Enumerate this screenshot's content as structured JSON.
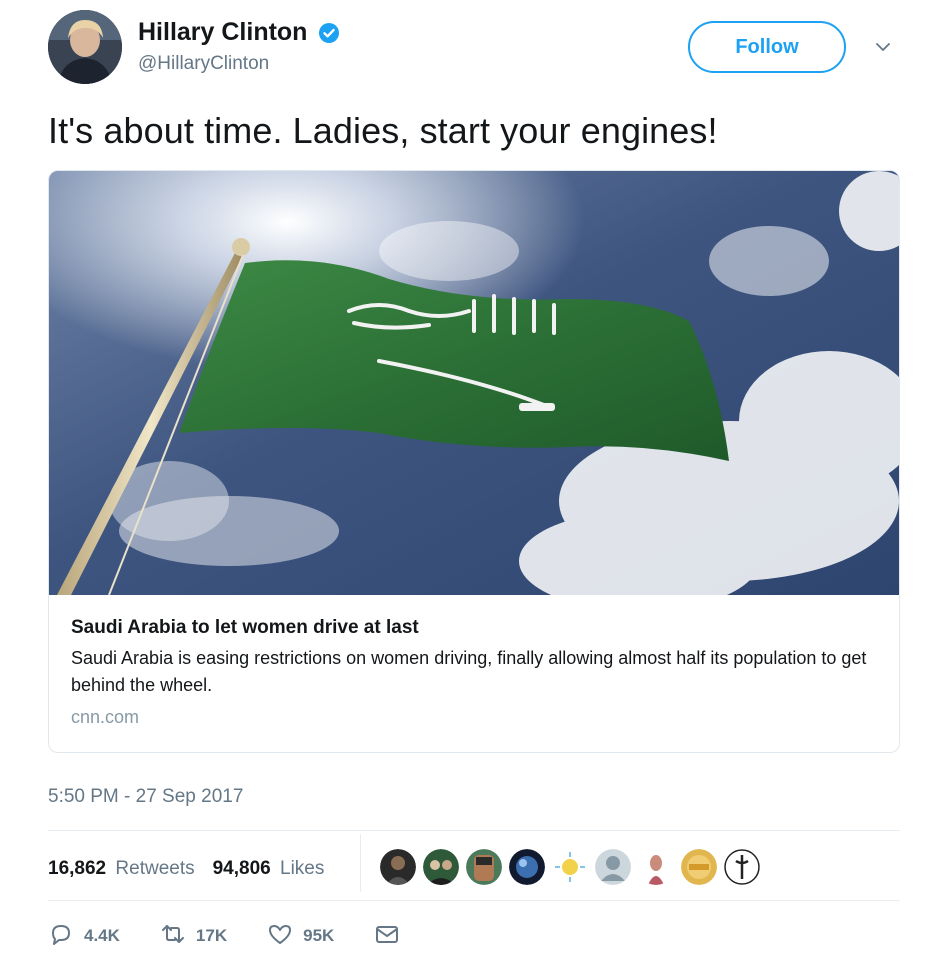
{
  "author": {
    "name": "Hillary Clinton",
    "handle": "@HillaryClinton",
    "verified": true
  },
  "follow_label": "Follow",
  "tweet_text": "It's about time. Ladies, start your engines!",
  "card": {
    "title": "Saudi Arabia to let women drive at last",
    "description": "Saudi Arabia is easing restrictions on women driving, finally allowing almost half its population to get behind the wheel.",
    "domain": "cnn.com"
  },
  "timestamp": "5:50 PM - 27 Sep 2017",
  "stats": {
    "retweets_count": "16,862",
    "retweets_label": "Retweets",
    "likes_count": "94,806",
    "likes_label": "Likes"
  },
  "actions": {
    "reply_count": "4.4K",
    "retweet_count": "17K",
    "like_count": "95K"
  },
  "icons": [
    "verified-icon",
    "chevron-down-icon",
    "reply-icon",
    "retweet-icon",
    "heart-icon",
    "message-icon"
  ],
  "colors": {
    "accent": "#1da1f2",
    "text": "#14171a",
    "muted": "#657786",
    "domain": "#8899a6",
    "border": "#e1e8ed",
    "flag_green": "#2f7a3a"
  }
}
